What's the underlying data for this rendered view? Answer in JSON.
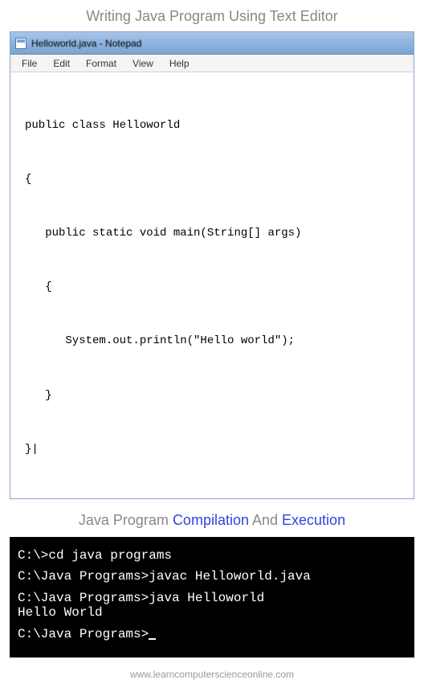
{
  "header": {
    "title": "Writing Java Program Using Text Editor"
  },
  "notepad": {
    "window_title": "Helloworld.java - Notepad",
    "menu": [
      "File",
      "Edit",
      "Format",
      "View",
      "Help"
    ],
    "code": [
      "public class Helloworld",
      "{",
      "   public static void main(String[] args)",
      "   {",
      "      System.out.println(\"Hello world\");",
      "   }",
      "}|"
    ]
  },
  "section2": {
    "prefix": "Java Program ",
    "compilation": "Compilation",
    "and": " And ",
    "execution": "Execution"
  },
  "terminal": {
    "lines": [
      {
        "text": "C:\\>cd java programs",
        "spacer": true
      },
      {
        "text": "C:\\Java Programs>javac Helloworld.java",
        "spacer": true
      },
      {
        "text": "C:\\Java Programs>java Helloworld",
        "spacer": false
      },
      {
        "text": "Hello World",
        "spacer": true
      }
    ],
    "prompt": "C:\\Java Programs>"
  },
  "footer": {
    "url": "www.learncomputerscienceonline.com"
  }
}
